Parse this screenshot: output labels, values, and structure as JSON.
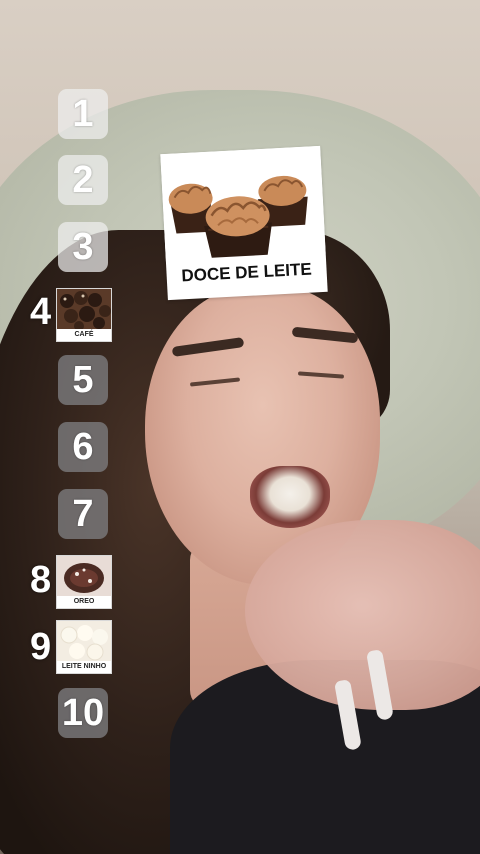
{
  "ranking": {
    "slots": [
      {
        "rank": "1",
        "filled": false
      },
      {
        "rank": "2",
        "filled": false
      },
      {
        "rank": "3",
        "filled": false
      },
      {
        "rank": "4",
        "filled": true,
        "label": "CAFÉ"
      },
      {
        "rank": "5",
        "filled": false
      },
      {
        "rank": "6",
        "filled": false
      },
      {
        "rank": "7",
        "filled": false
      },
      {
        "rank": "8",
        "filled": true,
        "label": "OREO"
      },
      {
        "rank": "9",
        "filled": true,
        "label": "LEITE NINHO"
      },
      {
        "rank": "10",
        "filled": false
      }
    ]
  },
  "current_pick": {
    "label": "DOCE DE LEITE"
  },
  "colors": {
    "slot_light": "#eeeeee",
    "slot_dark": "#7d7d80",
    "brigadeiro_brown": "#b5764a",
    "cup_brown": "#3a2216"
  }
}
